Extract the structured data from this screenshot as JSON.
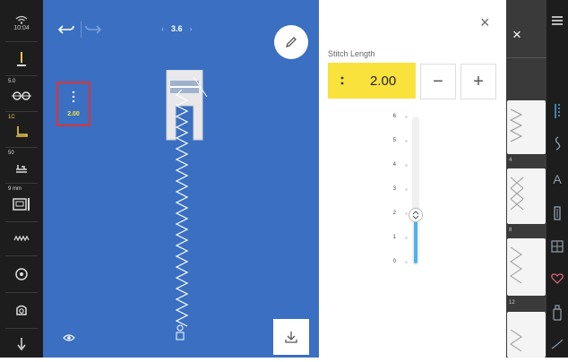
{
  "status": {
    "time": "10:04"
  },
  "left_bar": {
    "items": [
      {
        "name": "presser-foot-pressure",
        "badge": ""
      },
      {
        "name": "needle-tension",
        "badge": "5.0"
      },
      {
        "name": "presser-foot",
        "badge": "1C"
      },
      {
        "name": "feed-dog",
        "badge": "50"
      },
      {
        "name": "stitch-plate",
        "badge": "9 mm"
      },
      {
        "name": "bobbin-thread",
        "badge": ""
      },
      {
        "name": "needle-stop",
        "badge": ""
      },
      {
        "name": "thread-cutter",
        "badge": ""
      },
      {
        "name": "needle-position",
        "badge": ""
      }
    ]
  },
  "canvas": {
    "zoom": "3.6",
    "stitch_length_value": "2.00"
  },
  "panel": {
    "title": "Stitch Length",
    "value": "2.00",
    "minus": "−",
    "plus": "+",
    "close": "×",
    "scale_ticks": [
      "6",
      "5",
      "4",
      "3",
      "2",
      "1",
      "0"
    ],
    "slider_value": 2,
    "slider_min": 0,
    "slider_max": 6
  },
  "right_strip": {
    "close": "×",
    "stitch_numbers": [
      "4",
      "8",
      "12"
    ]
  },
  "colors": {
    "canvas_blue": "#3a6fc2",
    "accent_yellow": "#f9e23c",
    "slider_blue": "#4db2e8",
    "left_active_yellow": "#f2c94c",
    "dark_bar": "#1d1d1d"
  }
}
